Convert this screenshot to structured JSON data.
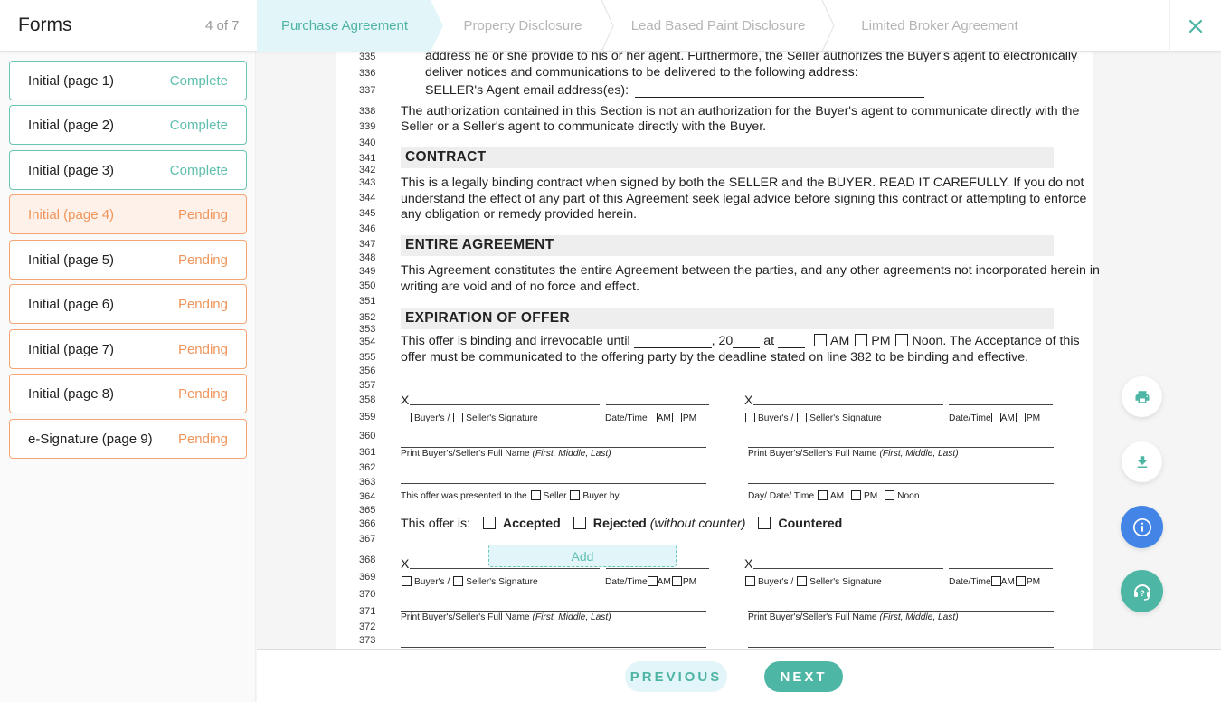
{
  "header": {
    "title": "Forms",
    "count": "4 of 7",
    "tabs": [
      {
        "label": "Purchase Agreement",
        "active": true
      },
      {
        "label": "Property Disclosure",
        "active": false
      },
      {
        "label": "Lead Based Paint Disclosure",
        "active": false
      },
      {
        "label": "Limited Broker Agreement",
        "active": false
      }
    ],
    "close_icon": "close-icon"
  },
  "sidebar": {
    "items": [
      {
        "label": "Initial (page 1)",
        "status": "Complete"
      },
      {
        "label": "Initial (page 2)",
        "status": "Complete"
      },
      {
        "label": "Initial (page 3)",
        "status": "Complete"
      },
      {
        "label": "Initial (page 4)",
        "status": "Pending",
        "current": true
      },
      {
        "label": "Initial (page 5)",
        "status": "Pending"
      },
      {
        "label": "Initial (page 6)",
        "status": "Pending"
      },
      {
        "label": "Initial (page 7)",
        "status": "Pending"
      },
      {
        "label": "Initial (page 8)",
        "status": "Pending"
      },
      {
        "label": "e-Signature (page 9)",
        "status": "Pending"
      }
    ]
  },
  "document": {
    "line_numbers": [
      "335",
      "336",
      "337",
      "338",
      "339",
      "340",
      "341",
      "342",
      "343",
      "344",
      "345",
      "346",
      "347",
      "348",
      "349",
      "350",
      "351",
      "352",
      "353",
      "354",
      "355",
      "356",
      "357",
      "358",
      "359",
      "360",
      "361",
      "362",
      "363",
      "364",
      "365",
      "366",
      "367",
      "368",
      "369",
      "370",
      "371",
      "372",
      "373"
    ],
    "para1_l1": "address he or she provide to his or her agent. Furthermore, the Seller authorizes the Buyer's agent to electronically",
    "para1_l2": "deliver notices and communications to be delivered to the following address:",
    "seller_agent_email_label": "SELLER's Agent email address(es):",
    "para2_l1": "The authorization contained in this Section is not an authorization for the Buyer's agent to communicate directly with the",
    "para2_l2": "Seller or a Seller's agent to communicate directly with the Buyer.",
    "section_contract": "CONTRACT",
    "contract_l1": "This is a legally binding contract when signed by both the SELLER and the BUYER. READ IT CAREFULLY. If you do not",
    "contract_l2": "understand the effect of any part of this Agreement seek legal advice before signing this contract or attempting to enforce",
    "contract_l3": "any obligation or remedy provided herein.",
    "section_entire": "ENTIRE AGREEMENT",
    "entire_l1": "This Agreement constitutes the entire Agreement between the parties, and any other agreements not incorporated herein in",
    "entire_l2": "writing are void and of no force and effect.",
    "section_expiration": "EXPIRATION OF OFFER",
    "exp_l1_a": "This offer is binding and irrevocable until",
    "exp_l1_b": ", 20",
    "exp_l1_c": "at",
    "exp_am": "AM",
    "exp_pm": "PM",
    "exp_noon": "Noon. The Acceptance of this",
    "exp_l2": "offer must be communicated to the offering party by the deadline stated on line 382 to be binding and effective.",
    "sig_x": "X",
    "buyers": "Buyer's /",
    "sellers_signature": "Seller's Signature",
    "date_time": "Date/Time",
    "am": "AM",
    "pm": "PM",
    "print_name": "Print Buyer's/Seller's Full Name",
    "print_name_italic": "(First, Middle, Last)",
    "presented_to": "This offer was presented to the",
    "presented_seller": "Seller",
    "presented_buyer_by": "Buyer by",
    "day_date_time": "Day/ Date/ Time",
    "noon": "Noon",
    "offer_is": "This offer is:",
    "accepted": "Accepted",
    "rejected": "Rejected",
    "rejected_note": "(without counter)",
    "countered": "Countered",
    "add_button": "Add"
  },
  "side_actions": [
    {
      "name": "print",
      "icon": "print-icon"
    },
    {
      "name": "download",
      "icon": "download-icon"
    },
    {
      "name": "info",
      "icon": "info-icon",
      "color": "#4285e6"
    },
    {
      "name": "support",
      "icon": "headset-help-icon",
      "color": "#4db6a4"
    }
  ],
  "footer": {
    "previous_label": "PREVIOUS",
    "next_label": "NEXT"
  },
  "colors": {
    "accent": "#4db6a4",
    "complete": "#5fbfae",
    "pending": "#ef955b",
    "info": "#4285e6"
  }
}
